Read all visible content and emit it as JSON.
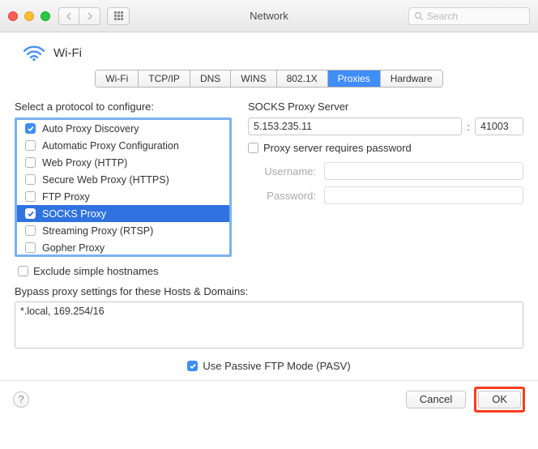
{
  "titlebar": {
    "title": "Network",
    "search_placeholder": "Search"
  },
  "header": {
    "label": "Wi-Fi"
  },
  "tabs": [
    "Wi-Fi",
    "TCP/IP",
    "DNS",
    "WINS",
    "802.1X",
    "Proxies",
    "Hardware"
  ],
  "tabs_active_index": 5,
  "left": {
    "label": "Select a protocol to configure:",
    "protocols": [
      {
        "label": "Auto Proxy Discovery",
        "checked": true,
        "selected": false
      },
      {
        "label": "Automatic Proxy Configuration",
        "checked": false,
        "selected": false
      },
      {
        "label": "Web Proxy (HTTP)",
        "checked": false,
        "selected": false
      },
      {
        "label": "Secure Web Proxy (HTTPS)",
        "checked": false,
        "selected": false
      },
      {
        "label": "FTP Proxy",
        "checked": false,
        "selected": false
      },
      {
        "label": "SOCKS Proxy",
        "checked": true,
        "selected": true
      },
      {
        "label": "Streaming Proxy (RTSP)",
        "checked": false,
        "selected": false
      },
      {
        "label": "Gopher Proxy",
        "checked": false,
        "selected": false
      }
    ]
  },
  "right": {
    "server_label": "SOCKS Proxy Server",
    "server_ip": "5.153.235.11",
    "server_port": "41003",
    "requires_password_label": "Proxy server requires password",
    "requires_password_checked": false,
    "username_label": "Username:",
    "password_label": "Password:"
  },
  "exclude": {
    "checked": false,
    "label": "Exclude simple hostnames"
  },
  "bypass": {
    "label": "Bypass proxy settings for these Hosts & Domains:",
    "value": "*.local, 169.254/16"
  },
  "pasv": {
    "checked": true,
    "label": "Use Passive FTP Mode (PASV)"
  },
  "footer": {
    "cancel": "Cancel",
    "ok": "OK"
  }
}
